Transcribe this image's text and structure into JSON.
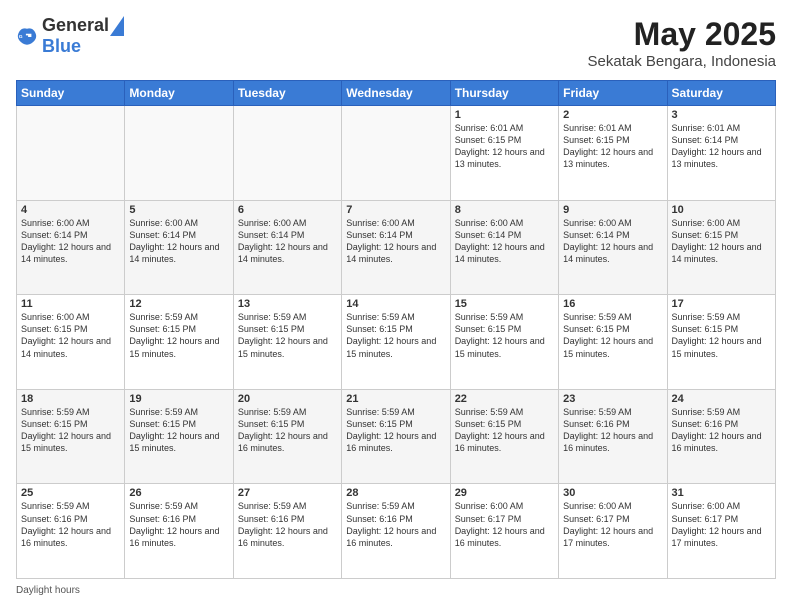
{
  "header": {
    "logo_general": "General",
    "logo_blue": "Blue",
    "month_year": "May 2025",
    "location": "Sekatak Bengara, Indonesia"
  },
  "days_of_week": [
    "Sunday",
    "Monday",
    "Tuesday",
    "Wednesday",
    "Thursday",
    "Friday",
    "Saturday"
  ],
  "weeks": [
    [
      {
        "day": "",
        "info": ""
      },
      {
        "day": "",
        "info": ""
      },
      {
        "day": "",
        "info": ""
      },
      {
        "day": "",
        "info": ""
      },
      {
        "day": "1",
        "info": "Sunrise: 6:01 AM\nSunset: 6:15 PM\nDaylight: 12 hours\nand 13 minutes."
      },
      {
        "day": "2",
        "info": "Sunrise: 6:01 AM\nSunset: 6:15 PM\nDaylight: 12 hours\nand 13 minutes."
      },
      {
        "day": "3",
        "info": "Sunrise: 6:01 AM\nSunset: 6:14 PM\nDaylight: 12 hours\nand 13 minutes."
      }
    ],
    [
      {
        "day": "4",
        "info": "Sunrise: 6:00 AM\nSunset: 6:14 PM\nDaylight: 12 hours\nand 14 minutes."
      },
      {
        "day": "5",
        "info": "Sunrise: 6:00 AM\nSunset: 6:14 PM\nDaylight: 12 hours\nand 14 minutes."
      },
      {
        "day": "6",
        "info": "Sunrise: 6:00 AM\nSunset: 6:14 PM\nDaylight: 12 hours\nand 14 minutes."
      },
      {
        "day": "7",
        "info": "Sunrise: 6:00 AM\nSunset: 6:14 PM\nDaylight: 12 hours\nand 14 minutes."
      },
      {
        "day": "8",
        "info": "Sunrise: 6:00 AM\nSunset: 6:14 PM\nDaylight: 12 hours\nand 14 minutes."
      },
      {
        "day": "9",
        "info": "Sunrise: 6:00 AM\nSunset: 6:14 PM\nDaylight: 12 hours\nand 14 minutes."
      },
      {
        "day": "10",
        "info": "Sunrise: 6:00 AM\nSunset: 6:15 PM\nDaylight: 12 hours\nand 14 minutes."
      }
    ],
    [
      {
        "day": "11",
        "info": "Sunrise: 6:00 AM\nSunset: 6:15 PM\nDaylight: 12 hours\nand 14 minutes."
      },
      {
        "day": "12",
        "info": "Sunrise: 5:59 AM\nSunset: 6:15 PM\nDaylight: 12 hours\nand 15 minutes."
      },
      {
        "day": "13",
        "info": "Sunrise: 5:59 AM\nSunset: 6:15 PM\nDaylight: 12 hours\nand 15 minutes."
      },
      {
        "day": "14",
        "info": "Sunrise: 5:59 AM\nSunset: 6:15 PM\nDaylight: 12 hours\nand 15 minutes."
      },
      {
        "day": "15",
        "info": "Sunrise: 5:59 AM\nSunset: 6:15 PM\nDaylight: 12 hours\nand 15 minutes."
      },
      {
        "day": "16",
        "info": "Sunrise: 5:59 AM\nSunset: 6:15 PM\nDaylight: 12 hours\nand 15 minutes."
      },
      {
        "day": "17",
        "info": "Sunrise: 5:59 AM\nSunset: 6:15 PM\nDaylight: 12 hours\nand 15 minutes."
      }
    ],
    [
      {
        "day": "18",
        "info": "Sunrise: 5:59 AM\nSunset: 6:15 PM\nDaylight: 12 hours\nand 15 minutes."
      },
      {
        "day": "19",
        "info": "Sunrise: 5:59 AM\nSunset: 6:15 PM\nDaylight: 12 hours\nand 15 minutes."
      },
      {
        "day": "20",
        "info": "Sunrise: 5:59 AM\nSunset: 6:15 PM\nDaylight: 12 hours\nand 16 minutes."
      },
      {
        "day": "21",
        "info": "Sunrise: 5:59 AM\nSunset: 6:15 PM\nDaylight: 12 hours\nand 16 minutes."
      },
      {
        "day": "22",
        "info": "Sunrise: 5:59 AM\nSunset: 6:15 PM\nDaylight: 12 hours\nand 16 minutes."
      },
      {
        "day": "23",
        "info": "Sunrise: 5:59 AM\nSunset: 6:16 PM\nDaylight: 12 hours\nand 16 minutes."
      },
      {
        "day": "24",
        "info": "Sunrise: 5:59 AM\nSunset: 6:16 PM\nDaylight: 12 hours\nand 16 minutes."
      }
    ],
    [
      {
        "day": "25",
        "info": "Sunrise: 5:59 AM\nSunset: 6:16 PM\nDaylight: 12 hours\nand 16 minutes."
      },
      {
        "day": "26",
        "info": "Sunrise: 5:59 AM\nSunset: 6:16 PM\nDaylight: 12 hours\nand 16 minutes."
      },
      {
        "day": "27",
        "info": "Sunrise: 5:59 AM\nSunset: 6:16 PM\nDaylight: 12 hours\nand 16 minutes."
      },
      {
        "day": "28",
        "info": "Sunrise: 5:59 AM\nSunset: 6:16 PM\nDaylight: 12 hours\nand 16 minutes."
      },
      {
        "day": "29",
        "info": "Sunrise: 6:00 AM\nSunset: 6:17 PM\nDaylight: 12 hours\nand 16 minutes."
      },
      {
        "day": "30",
        "info": "Sunrise: 6:00 AM\nSunset: 6:17 PM\nDaylight: 12 hours\nand 17 minutes."
      },
      {
        "day": "31",
        "info": "Sunrise: 6:00 AM\nSunset: 6:17 PM\nDaylight: 12 hours\nand 17 minutes."
      }
    ]
  ],
  "footer": {
    "daylight_label": "Daylight hours"
  }
}
